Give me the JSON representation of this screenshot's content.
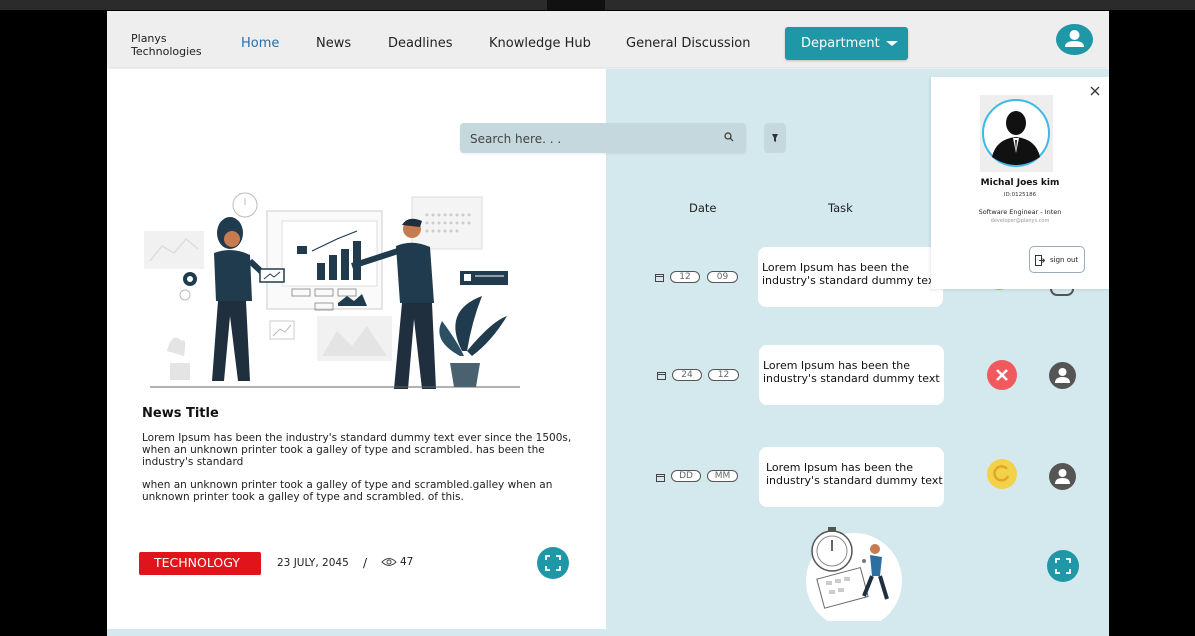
{
  "brand": {
    "line1": "Planys",
    "line2": "Technologies"
  },
  "nav": {
    "home": "Home",
    "news": "News",
    "deadlines": "Deadlines",
    "knowledge_hub": "Knowledge Hub",
    "general_discussion": "General Discussion",
    "department": "Department",
    "avatar_icon": "user-icon"
  },
  "search": {
    "placeholder": "Search here. . .",
    "icon": "search-icon",
    "filter_icon": "filter-icon"
  },
  "news": {
    "title": "News Title",
    "paragraph1": "Lorem Ipsum has been the industry's standard dummy text ever since the 1500s, when an unknown printer took a galley of type and scrambled. has been the industry's standard",
    "paragraph2": "when an unknown printer took a galley of type and scrambled.galley when an unknown printer took a galley of type and scrambled. of this.",
    "tag": "TECHNOLOGY",
    "date": "23 JULY, 2045",
    "separator": "/",
    "views": "47"
  },
  "tasks": {
    "headers": {
      "date": "Date",
      "task": "Task"
    },
    "rows": [
      {
        "day": "12",
        "month": "09",
        "text_line1": "Lorem Ipsum has been the",
        "text_line2": "industry's standard dummy text",
        "status": "done"
      },
      {
        "day": "24",
        "month": "12",
        "text_line1": "Lorem Ipsum has been the",
        "text_line2": "industry's standard dummy text",
        "status": "rejected"
      },
      {
        "day": "DD",
        "month": "MM",
        "text_line1": "Lorem Ipsum has been the",
        "text_line2": "industry's standard dummy text",
        "status": "pending"
      }
    ]
  },
  "profile_popup": {
    "name": "Michal Joes kim",
    "id": "ID:0125186",
    "role": "Software Enginear - Inten",
    "email": "developer@planys.com",
    "signout": "sign out"
  },
  "colors": {
    "accent": "#1f97a7",
    "panel": "#d3e9ee",
    "tag_red": "#e0141b",
    "status_rejected": "#f05a5e",
    "status_pending": "#f3d24a",
    "nav_active": "#2a6ea5"
  }
}
